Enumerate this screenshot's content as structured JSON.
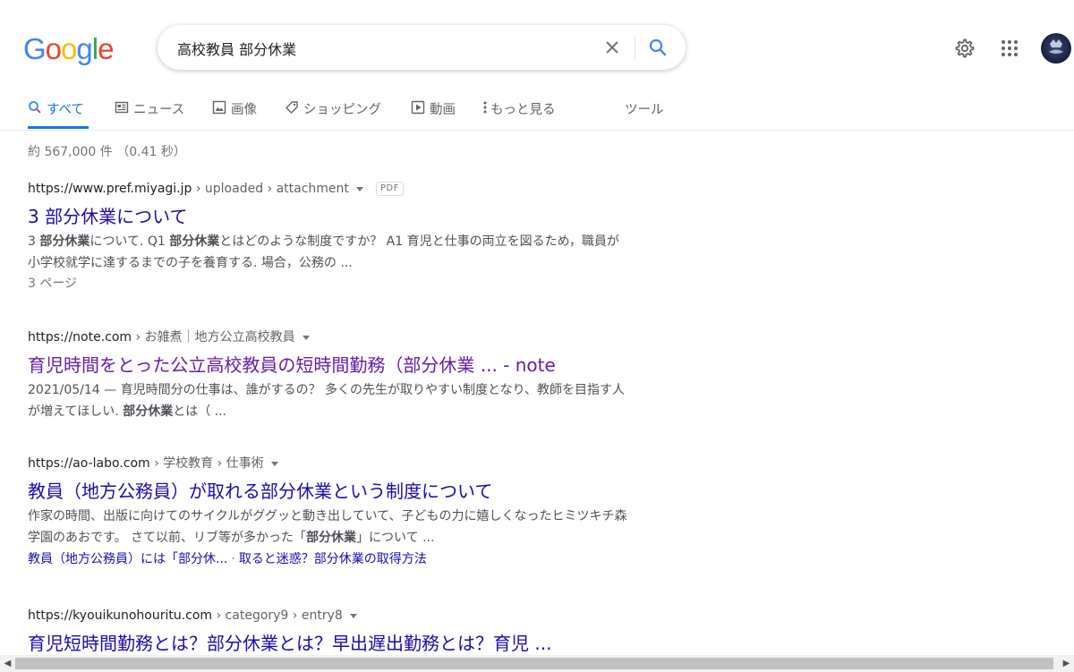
{
  "logo": {
    "letters": [
      "G",
      "o",
      "o",
      "g",
      "l",
      "e"
    ],
    "colors": [
      "#4285f4",
      "#ea4335",
      "#fbbc05",
      "#4285f4",
      "#34a853",
      "#ea4335"
    ]
  },
  "search": {
    "query": "高校教員 部分休業"
  },
  "tabs": [
    {
      "label": "すべて",
      "icon": "search-icon"
    },
    {
      "label": "ニュース",
      "icon": "news-icon"
    },
    {
      "label": "画像",
      "icon": "image-icon"
    },
    {
      "label": "ショッピング",
      "icon": "tag-icon"
    },
    {
      "label": "動画",
      "icon": "video-icon"
    },
    {
      "label": "もっと見る",
      "icon": "more-vert-icon"
    },
    {
      "label": "ツール"
    }
  ],
  "stats": "約 567,000 件 （0.41 秒）",
  "results": [
    {
      "site": "https://www.pref.miyagi.jp",
      "path": " › uploaded › attachment",
      "badge": "PDF",
      "title": "3 部分休業について",
      "snippet": [
        {
          "t": "3 "
        },
        {
          "t": "部分休業",
          "b": true
        },
        {
          "t": "について. Q1 "
        },
        {
          "t": "部分休業",
          "b": true
        },
        {
          "t": "とはどのような制度ですか？ A1 育児と仕事の両立を図るため，職員が小学校就学に達するまでの子を養育する. 場合，公務の ..."
        }
      ],
      "meta": "3 ページ"
    },
    {
      "site": "https://note.com",
      "path": " › お雑煮｜地方公立高校教員",
      "title": "育児時間をとった公立高校教員の短時間勤務（部分休業 ... - note",
      "visited": true,
      "snippet": [
        {
          "t": "2021/05/14 — 育児時間分の仕事は、誰がするの？ 多くの先生が取りやすい制度となり、教師を目指す人が増えてほしい. "
        },
        {
          "t": "部分休業",
          "b": true
        },
        {
          "t": "とは（ ..."
        }
      ]
    },
    {
      "site": "https://ao-labo.com",
      "path": " › 学校教育 › 仕事術",
      "title": "教員（地方公務員）が取れる部分休業という制度について",
      "snippet": [
        {
          "t": "作家の時間、出版に向けてのサイクルがググッと動き出していて、子どもの力に嬉しくなったヒミツキチ森学園のあおです。 さて以前、リブ等が多かった「"
        },
        {
          "t": "部分休業",
          "b": true
        },
        {
          "t": "」について ..."
        }
      ],
      "sitelinks": [
        "教員（地方公務員）には「部分休...",
        "取ると迷惑？部分休業の取得方法"
      ]
    },
    {
      "site": "https://kyouikunohouritu.com",
      "path": " › category9 › entry8",
      "title": "育児短時間勤務とは？部分休業とは？早出遅出勤務とは？育児 ..."
    }
  ]
}
